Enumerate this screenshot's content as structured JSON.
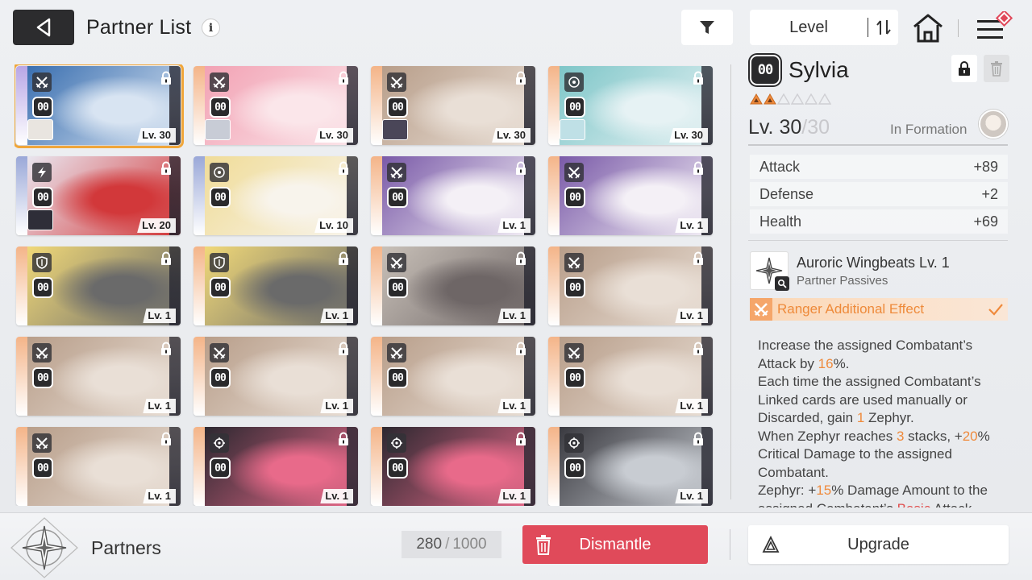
{
  "header": {
    "title": "Partner List",
    "info_glyph": "i",
    "sort_label": "Level"
  },
  "cards": [
    {
      "level": "Lv. 30",
      "rank": "00",
      "class_icon": "sword-cross-icon",
      "stripe": "#b8a6e6",
      "art": [
        "#3a6fb0",
        "#d8e4f2"
      ],
      "has_avatar": true,
      "avatar_color": "#e9e5e0",
      "selected": true
    },
    {
      "level": "Lv. 30",
      "rank": "00",
      "class_icon": "sword-cross-icon",
      "stripe": "#f4b488",
      "art": [
        "#f2a2b4",
        "#fbe6ea"
      ],
      "has_avatar": true,
      "avatar_color": "#c8ccd6",
      "selected": false
    },
    {
      "level": "Lv. 30",
      "rank": "00",
      "class_icon": "sword-cross-icon",
      "stripe": "#f4b488",
      "art": [
        "#b89e8a",
        "#e9dfd6"
      ],
      "has_avatar": true,
      "avatar_color": "#4a4658",
      "selected": false
    },
    {
      "level": "Lv. 30",
      "rank": "00",
      "class_icon": "target-icon",
      "stripe": "#f4b488",
      "art": [
        "#7ec6c8",
        "#e6f2f4"
      ],
      "has_avatar": true,
      "avatar_color": "#bfe0e6",
      "selected": false
    },
    {
      "level": "Lv. 20",
      "rank": "00",
      "class_icon": "lightning-icon",
      "stripe": "#9aa8d8",
      "art": [
        "#e9e6ef",
        "#d2383a"
      ],
      "has_avatar": true,
      "avatar_color": "#2e2e38",
      "selected": false
    },
    {
      "level": "Lv. 10",
      "rank": "00",
      "class_icon": "target-icon",
      "stripe": "#9aa8d8",
      "art": [
        "#f0dc98",
        "#f8f4ec"
      ],
      "has_avatar": false,
      "avatar_color": "",
      "selected": false
    },
    {
      "level": "Lv. 1",
      "rank": "00",
      "class_icon": "sword-cross-icon",
      "stripe": "#f4b488",
      "art": [
        "#7a5aa8",
        "#f4f0f6"
      ],
      "has_avatar": false,
      "avatar_color": "",
      "selected": false
    },
    {
      "level": "Lv. 1",
      "rank": "00",
      "class_icon": "sword-cross-icon",
      "stripe": "#f4b488",
      "art": [
        "#7a5aa8",
        "#f4f0f6"
      ],
      "has_avatar": false,
      "avatar_color": "",
      "selected": false
    },
    {
      "level": "Lv. 1",
      "rank": "00",
      "class_icon": "shield-icon",
      "stripe": "#f4b488",
      "art": [
        "#f0d878",
        "#6a6a6a"
      ],
      "has_avatar": false,
      "avatar_color": "",
      "selected": false
    },
    {
      "level": "Lv. 1",
      "rank": "00",
      "class_icon": "shield-icon",
      "stripe": "#f4b488",
      "art": [
        "#f0d878",
        "#6a6a6a"
      ],
      "has_avatar": false,
      "avatar_color": "",
      "selected": false
    },
    {
      "level": "Lv. 1",
      "rank": "00",
      "class_icon": "sword-cross-icon",
      "stripe": "#f4b488",
      "art": [
        "#c8c0b8",
        "#6e6666"
      ],
      "has_avatar": false,
      "avatar_color": "",
      "selected": false
    },
    {
      "level": "Lv. 1",
      "rank": "00",
      "class_icon": "sword-cross-icon",
      "stripe": "#f4b488",
      "art": [
        "#b89e8a",
        "#e9dfd6"
      ],
      "has_avatar": false,
      "avatar_color": "",
      "selected": false
    },
    {
      "level": "Lv. 1",
      "rank": "00",
      "class_icon": "sword-cross-icon",
      "stripe": "#f4b488",
      "art": [
        "#b89e8a",
        "#e9dfd6"
      ],
      "has_avatar": false,
      "avatar_color": "",
      "selected": false
    },
    {
      "level": "Lv. 1",
      "rank": "00",
      "class_icon": "sword-cross-icon",
      "stripe": "#f4b488",
      "art": [
        "#b89e8a",
        "#e9dfd6"
      ],
      "has_avatar": false,
      "avatar_color": "",
      "selected": false
    },
    {
      "level": "Lv. 1",
      "rank": "00",
      "class_icon": "sword-cross-icon",
      "stripe": "#f4b488",
      "art": [
        "#b89e8a",
        "#e9dfd6"
      ],
      "has_avatar": false,
      "avatar_color": "",
      "selected": false
    },
    {
      "level": "Lv. 1",
      "rank": "00",
      "class_icon": "sword-cross-icon",
      "stripe": "#f4b488",
      "art": [
        "#b89e8a",
        "#e9dfd6"
      ],
      "has_avatar": false,
      "avatar_color": "",
      "selected": false
    },
    {
      "level": "Lv. 1",
      "rank": "00",
      "class_icon": "sword-cross-icon",
      "stripe": "#f4b488",
      "art": [
        "#b89e8a",
        "#e9dfd6"
      ],
      "has_avatar": false,
      "avatar_color": "",
      "selected": false
    },
    {
      "level": "Lv. 1",
      "rank": "00",
      "class_icon": "gear-target-icon",
      "stripe": "#f4b488",
      "art": [
        "#2c2830",
        "#e86a8a"
      ],
      "has_avatar": false,
      "avatar_color": "",
      "selected": false
    },
    {
      "level": "Lv. 1",
      "rank": "00",
      "class_icon": "gear-target-icon",
      "stripe": "#f4b488",
      "art": [
        "#2c2830",
        "#e86a8a"
      ],
      "has_avatar": false,
      "avatar_color": "",
      "selected": false
    },
    {
      "level": "Lv. 1",
      "rank": "00",
      "class_icon": "gear-target-icon",
      "stripe": "#f4b488",
      "art": [
        "#3a3a40",
        "#c8ccd2"
      ],
      "has_avatar": false,
      "avatar_color": "",
      "selected": false
    }
  ],
  "detail": {
    "rank": "00",
    "name": "Sylvia",
    "stars_filled": 2,
    "stars_total": 6,
    "level_prefix": "Lv. 30",
    "level_sep": "/",
    "level_max": "30",
    "formation_label": "In Formation",
    "stats": [
      {
        "label": "Attack",
        "value": "+89"
      },
      {
        "label": "Defense",
        "value": "+2"
      },
      {
        "label": "Health",
        "value": "+69"
      }
    ],
    "passive_name": "Auroric Wingbeats Lv. 1",
    "passive_sub": "Partner Passives",
    "effect_label": "Ranger Additional Effect",
    "desc": {
      "p1a": "Increase the assigned Combatant’s Attack by ",
      "p1v": "16",
      "p1b": "%.",
      "p2a": "Each time the assigned Combatant’s Linked cards are used manually or Discarded, gain ",
      "p2v": "1",
      "p2b": " Zephyr.",
      "p3a": "When Zephyr reaches ",
      "p3v": "3",
      "p3b": " stacks, +",
      "p3v2": "20",
      "p3c": "% Critical Damage to the assigned Combatant.",
      "p4a": "Zephyr: +",
      "p4v": "15",
      "p4b": "% Damage Amount to the assigned Combatant’s ",
      "p4v2": "Basic",
      "p4c": " Attack"
    }
  },
  "bottom": {
    "label": "Partners",
    "count_current": "280",
    "count_sep": "/",
    "count_total": "1000",
    "dismantle_label": "Dismantle",
    "upgrade_label": "Upgrade"
  },
  "colors": {
    "accent_orange": "#ef8a3c",
    "dismantle_red": "#e04a5a",
    "selected_outline": "#f0a63a",
    "dark": "#2c2c2e"
  }
}
